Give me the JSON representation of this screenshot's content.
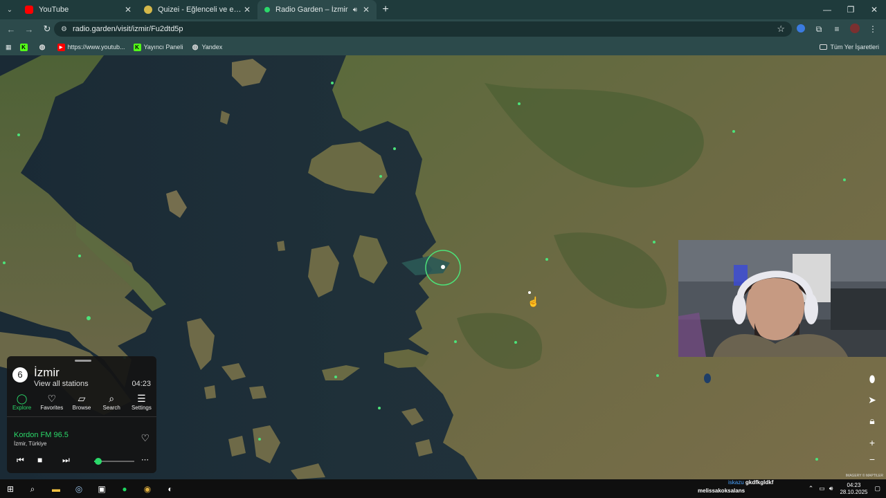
{
  "browser": {
    "tabs": [
      {
        "title": "YouTube",
        "favicon_color": "#ff0000",
        "active": false
      },
      {
        "title": "Quizei - Eğlenceli ve etkileşimli",
        "favicon_color": "#d4b84a",
        "active": false
      },
      {
        "title": "Radio Garden – İzmir",
        "favicon_color": "#2bd96a",
        "active": true
      }
    ],
    "url": "radio.garden/visit/izmir/Fu2dtd5p",
    "bookmarks": [
      {
        "label": "",
        "icon": "kick-icon",
        "color": "#53fc18"
      },
      {
        "label": "",
        "icon": "globe-icon",
        "color": "#cccccc"
      },
      {
        "label": "https://www.youtub...",
        "icon": "youtube-icon",
        "color": "#ff0000"
      },
      {
        "label": "Yayıncı Paneli",
        "icon": "kick-icon",
        "color": "#53fc18"
      },
      {
        "label": "Yandex",
        "icon": "globe-icon",
        "color": "#cccccc"
      }
    ],
    "all_bookmarks": "Tüm Yer İşaretleri"
  },
  "map": {
    "credit": "IMAGERY © MAPTILER"
  },
  "radio": {
    "station_count": "6",
    "city": "İzmir",
    "view_all": "View all stations",
    "time": "04:23",
    "nav": [
      {
        "label": "Explore",
        "icon": "explore-icon",
        "glyph": "◯",
        "active": true
      },
      {
        "label": "Favorites",
        "icon": "heart-icon",
        "glyph": "♡",
        "active": false
      },
      {
        "label": "Browse",
        "icon": "map-icon",
        "glyph": "▱",
        "active": false
      },
      {
        "label": "Search",
        "icon": "search-icon",
        "glyph": "⌕",
        "active": false
      },
      {
        "label": "Settings",
        "icon": "menu-icon",
        "glyph": "☰",
        "active": false
      }
    ],
    "now_playing": {
      "station": "Kordon FM 96.5",
      "location": "İzmir, Türkiye"
    },
    "volume": 0.1,
    "accent": "#2bd96a"
  },
  "taskbar": {
    "chat_user": "iskazu",
    "chat_msg": "gkdfkgldkf",
    "chat_user2": "melissakoksalans",
    "time": "04:23",
    "date": "28.10.2025"
  }
}
